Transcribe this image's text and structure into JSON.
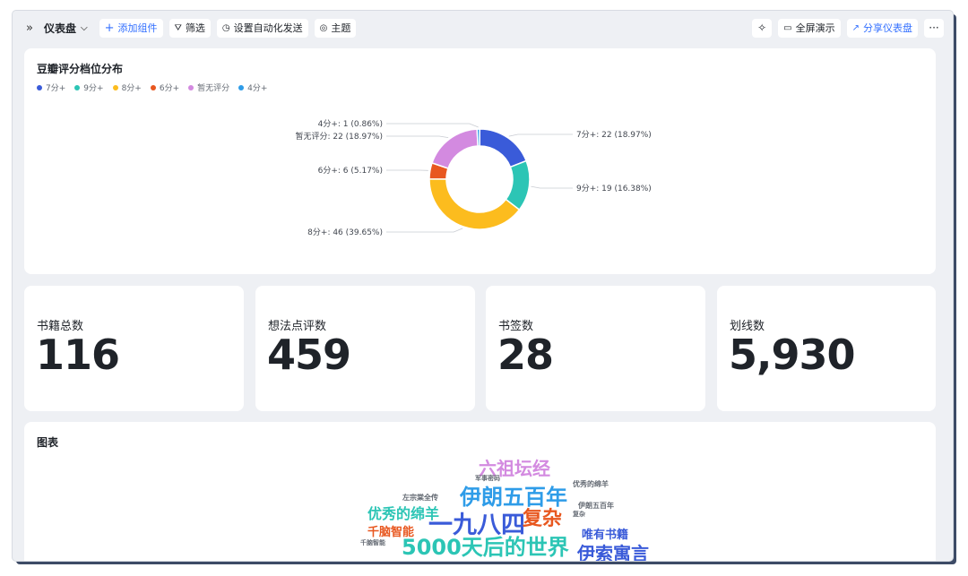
{
  "toolbar": {
    "expand_icon": "double-chevron-right-icon",
    "title": "仪表盘",
    "add_widget": "添加组件",
    "filter": "筛选",
    "auto_send": "设置自动化发送",
    "theme": "主题",
    "fullscreen": "全屏演示",
    "share": "分享仪表盘"
  },
  "donut_card": {
    "title": "豆瓣评分档位分布"
  },
  "chart_data": {
    "type": "pie",
    "title": "豆瓣评分档位分布",
    "legend_position": "top-left",
    "slices": [
      {
        "name": "7分+",
        "value": 22,
        "percent": "18.97%",
        "label": "7分+: 22 (18.97%)",
        "color": "#3a5bd9"
      },
      {
        "name": "9分+",
        "value": 19,
        "percent": "16.38%",
        "label": "9分+: 19 (16.38%)",
        "color": "#2cc5b5"
      },
      {
        "name": "8分+",
        "value": 46,
        "percent": "39.65%",
        "label": "8分+: 46 (39.65%)",
        "color": "#fcbc1e"
      },
      {
        "name": "6分+",
        "value": 6,
        "percent": "5.17%",
        "label": "6分+: 6 (5.17%)",
        "color": "#e8571f"
      },
      {
        "name": "暂无评分",
        "value": 22,
        "percent": "18.97%",
        "label": "暂无评分: 22 (18.97%)",
        "color": "#d38ae0"
      },
      {
        "name": "4分+",
        "value": 1,
        "percent": "0.86%",
        "label": "4分+: 1 (0.86%)",
        "color": "#2e9ce8"
      }
    ]
  },
  "stats": [
    {
      "label": "书籍总数",
      "value": "116"
    },
    {
      "label": "想法点评数",
      "value": "459"
    },
    {
      "label": "书签数",
      "value": "28"
    },
    {
      "label": "划线数",
      "value": "5,930"
    }
  ],
  "cloud_card": {
    "title": "图表",
    "words": [
      {
        "text": "六祖坛经",
        "color": "#d38ae0"
      },
      {
        "text": "伊朗五百年",
        "color": "#2e9ce8"
      },
      {
        "text": "优秀的绵羊",
        "color": "#2cc5b5"
      },
      {
        "text": "一九八四",
        "color": "#3a5bd9"
      },
      {
        "text": "复杂",
        "color": "#e8571f"
      },
      {
        "text": "千脑智能",
        "color": "#e8571f"
      },
      {
        "text": "唯有书籍",
        "color": "#3a5bd9"
      },
      {
        "text": "5000天后的世界",
        "color": "#2cc5b5"
      },
      {
        "text": "伊索寓言",
        "color": "#3a5bd9"
      },
      {
        "text": "左宗棠全传",
        "color": "#646a73"
      },
      {
        "text": "优秀的绵羊",
        "color": "#646a73"
      },
      {
        "text": "伊朗五百年",
        "color": "#646a73"
      },
      {
        "text": "复杂",
        "color": "#646a73"
      },
      {
        "text": "千脑智能",
        "color": "#646a73"
      },
      {
        "text": "军事密码",
        "color": "#646a73"
      }
    ]
  }
}
